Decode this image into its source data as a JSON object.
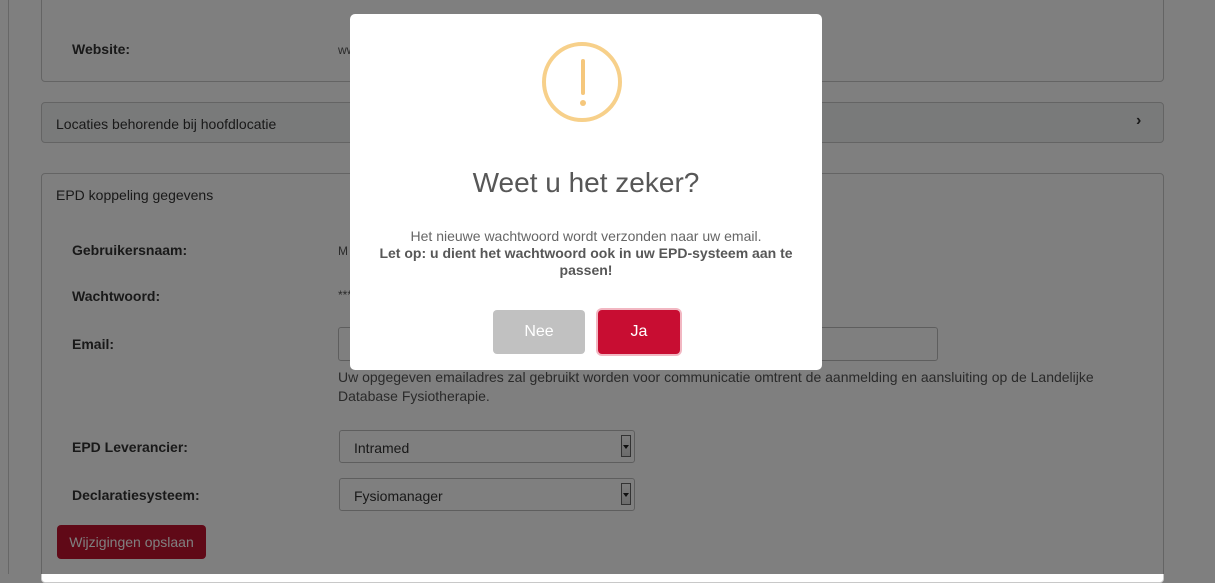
{
  "website": {
    "label": "Website:",
    "value": "www."
  },
  "locaties": {
    "title": "Locaties behorende bij hoofdlocatie",
    "chevron": "›"
  },
  "epd": {
    "title": "EPD koppeling gegevens",
    "username_label": "Gebruikersnaam:",
    "username_value": "M",
    "password_label": "Wachtwoord:",
    "password_value": "***",
    "email_label": "Email:",
    "email_help": "Uw opgegeven emailadres zal gebruikt worden voor communicatie omtrent de aanmelding en aansluiting op de Landelijke Database Fysiotherapie.",
    "leverancier_label": "EPD Leverancier:",
    "leverancier_value": "Intramed",
    "declaratie_label": "Declaratiesysteem:",
    "declaratie_value": "Fysiomanager",
    "save_label": "Wijzigingen opslaan"
  },
  "modal": {
    "icon": "warning-icon",
    "title": "Weet u het zeker?",
    "text": "Het nieuwe wachtwoord wordt verzonden naar uw email.",
    "warning": "Let op: u dient het wachtwoord ook in uw EPD-systeem aan te passen!",
    "cancel_label": "Nee",
    "confirm_label": "Ja"
  },
  "colors": {
    "brand_red": "#c0122e",
    "warning_yellow": "#f7d08a",
    "cancel_gray": "#c1c1c1"
  }
}
